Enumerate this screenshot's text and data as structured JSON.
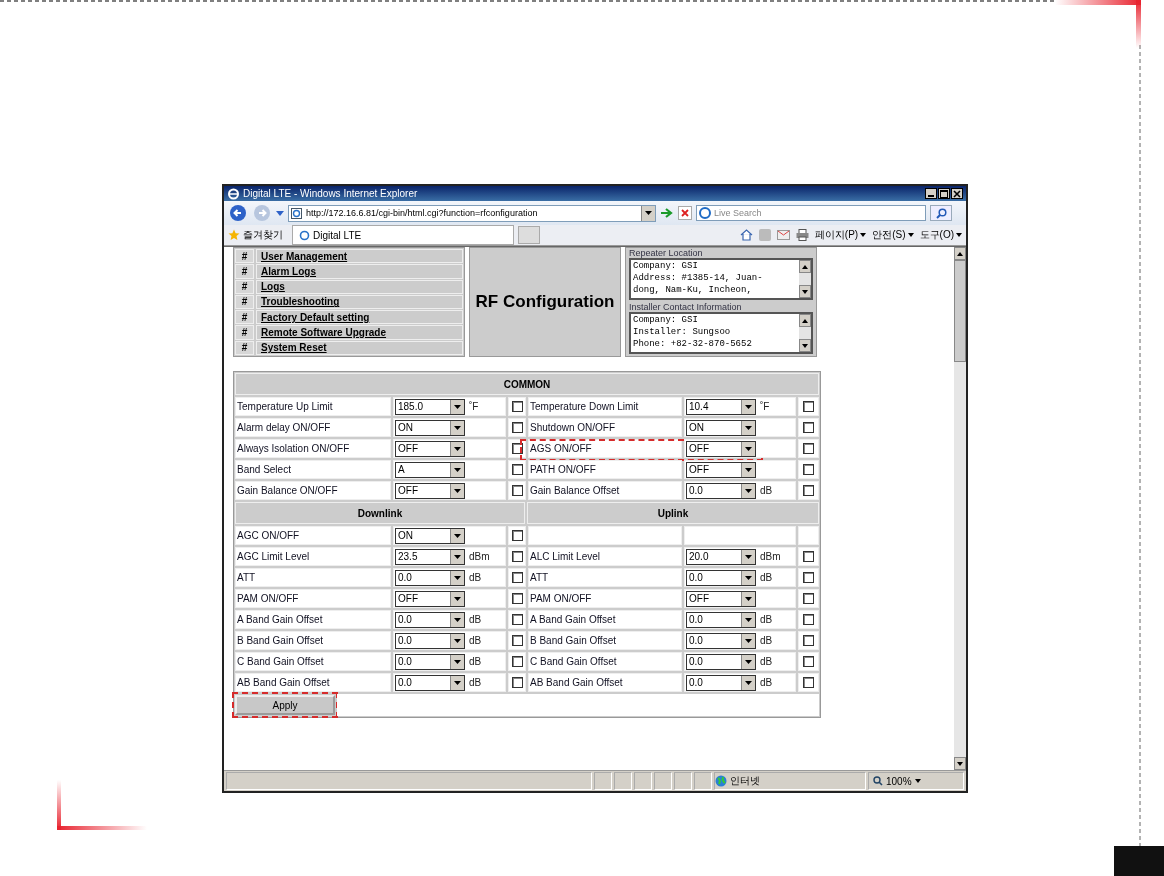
{
  "window": {
    "title": "Digital LTE - Windows Internet Explorer"
  },
  "toolbar": {
    "address": "http://172.16.6.81/cgi-bin/html.cgi?function=rfconfiguration",
    "search_placeholder": "Live Search",
    "favorites": "즐겨찾기",
    "tab": "Digital LTE",
    "commands": [
      "페이지(P)",
      "안전(S)",
      "도구(O)"
    ]
  },
  "menu": [
    "User Management",
    "Alarm Logs",
    "Logs",
    "Troubleshooting",
    "Factory Default setting",
    "Remote Software Upgrade",
    "System Reset"
  ],
  "menu_marker": "#",
  "heading": "RF Configuration",
  "info_boxes": [
    {
      "label": "Repeater Location",
      "lines": [
        "Company: GSI",
        "Address: #1385-14, Juan-",
        "dong, Nam-Ku, Incheon,"
      ]
    },
    {
      "label": "Installer Contact Information",
      "lines": [
        "Company: GSI",
        "Installer: Sungsoo",
        "Phone: +82-32-870-5652"
      ]
    }
  ],
  "common": {
    "title": "COMMON",
    "rows": [
      {
        "left": {
          "label": "Temperature Up Limit",
          "value": "185.0",
          "unit": "˚F",
          "checked": false,
          "highlighted": false
        },
        "right": {
          "label": "Temperature Down Limit",
          "value": "10.4",
          "unit": "˚F",
          "checked": false,
          "highlighted": false
        }
      },
      {
        "left": {
          "label": "Alarm delay ON/OFF",
          "value": "ON",
          "checked": false,
          "highlighted": false
        },
        "right": {
          "label": "Shutdown ON/OFF",
          "value": "ON",
          "checked": false,
          "highlighted": false
        }
      },
      {
        "left": {
          "label": "Always Isolation ON/OFF",
          "value": "OFF",
          "checked": false,
          "highlighted": false
        },
        "right": {
          "label": "AGS ON/OFF",
          "value": "OFF",
          "checked": false,
          "highlighted": true
        }
      },
      {
        "left": {
          "label": "Band Select",
          "value": "A",
          "checked": false,
          "highlighted": false
        },
        "right": {
          "label": "PATH ON/OFF",
          "value": "OFF",
          "checked": false,
          "highlighted": false
        }
      },
      {
        "left": {
          "label": "Gain Balance ON/OFF",
          "value": "OFF",
          "checked": false,
          "highlighted": false
        },
        "right": {
          "label": "Gain Balance Offset",
          "value": "0.0",
          "unit": "dB",
          "checked": false,
          "highlighted": false
        }
      }
    ]
  },
  "links": {
    "left_title": "Downlink",
    "right_title": "Uplink",
    "rows": [
      {
        "left": {
          "label": "AGC ON/OFF",
          "value": "ON",
          "checked": false,
          "highlighted": false
        },
        "right": null
      },
      {
        "left": {
          "label": "AGC Limit Level",
          "value": "23.5",
          "unit": "dBm",
          "checked": false,
          "highlighted": false
        },
        "right": {
          "label": "ALC Limit Level",
          "value": "20.0",
          "unit": "dBm",
          "checked": false,
          "highlighted": false
        }
      },
      {
        "left": {
          "label": "ATT",
          "value": "0.0",
          "unit": "dB",
          "checked": false,
          "highlighted": false
        },
        "right": {
          "label": "ATT",
          "value": "0.0",
          "unit": "dB",
          "checked": false,
          "highlighted": false
        }
      },
      {
        "left": {
          "label": "PAM ON/OFF",
          "value": "OFF",
          "checked": false,
          "highlighted": false
        },
        "right": {
          "label": "PAM ON/OFF",
          "value": "OFF",
          "checked": false,
          "highlighted": false
        }
      },
      {
        "left": {
          "label": "A Band Gain Offset",
          "value": "0.0",
          "unit": "dB",
          "checked": false,
          "highlighted": false
        },
        "right": {
          "label": "A Band Gain Offset",
          "value": "0.0",
          "unit": "dB",
          "checked": false,
          "highlighted": false
        }
      },
      {
        "left": {
          "label": "B Band Gain Offset",
          "value": "0.0",
          "unit": "dB",
          "checked": false,
          "highlighted": false
        },
        "right": {
          "label": "B Band Gain Offset",
          "value": "0.0",
          "unit": "dB",
          "checked": false,
          "highlighted": false
        }
      },
      {
        "left": {
          "label": "C Band Gain Offset",
          "value": "0.0",
          "unit": "dB",
          "checked": false,
          "highlighted": false
        },
        "right": {
          "label": "C Band Gain Offset",
          "value": "0.0",
          "unit": "dB",
          "checked": false,
          "highlighted": false
        }
      },
      {
        "left": {
          "label": "AB Band Gain Offset",
          "value": "0.0",
          "unit": "dB",
          "checked": false,
          "highlighted": false
        },
        "right": {
          "label": "AB Band Gain Offset",
          "value": "0.0",
          "unit": "dB",
          "checked": false,
          "highlighted": false
        }
      }
    ]
  },
  "apply": {
    "label": "Apply",
    "highlighted": true
  },
  "status_bar": {
    "zone": "인터넷",
    "zoom": "100%"
  }
}
